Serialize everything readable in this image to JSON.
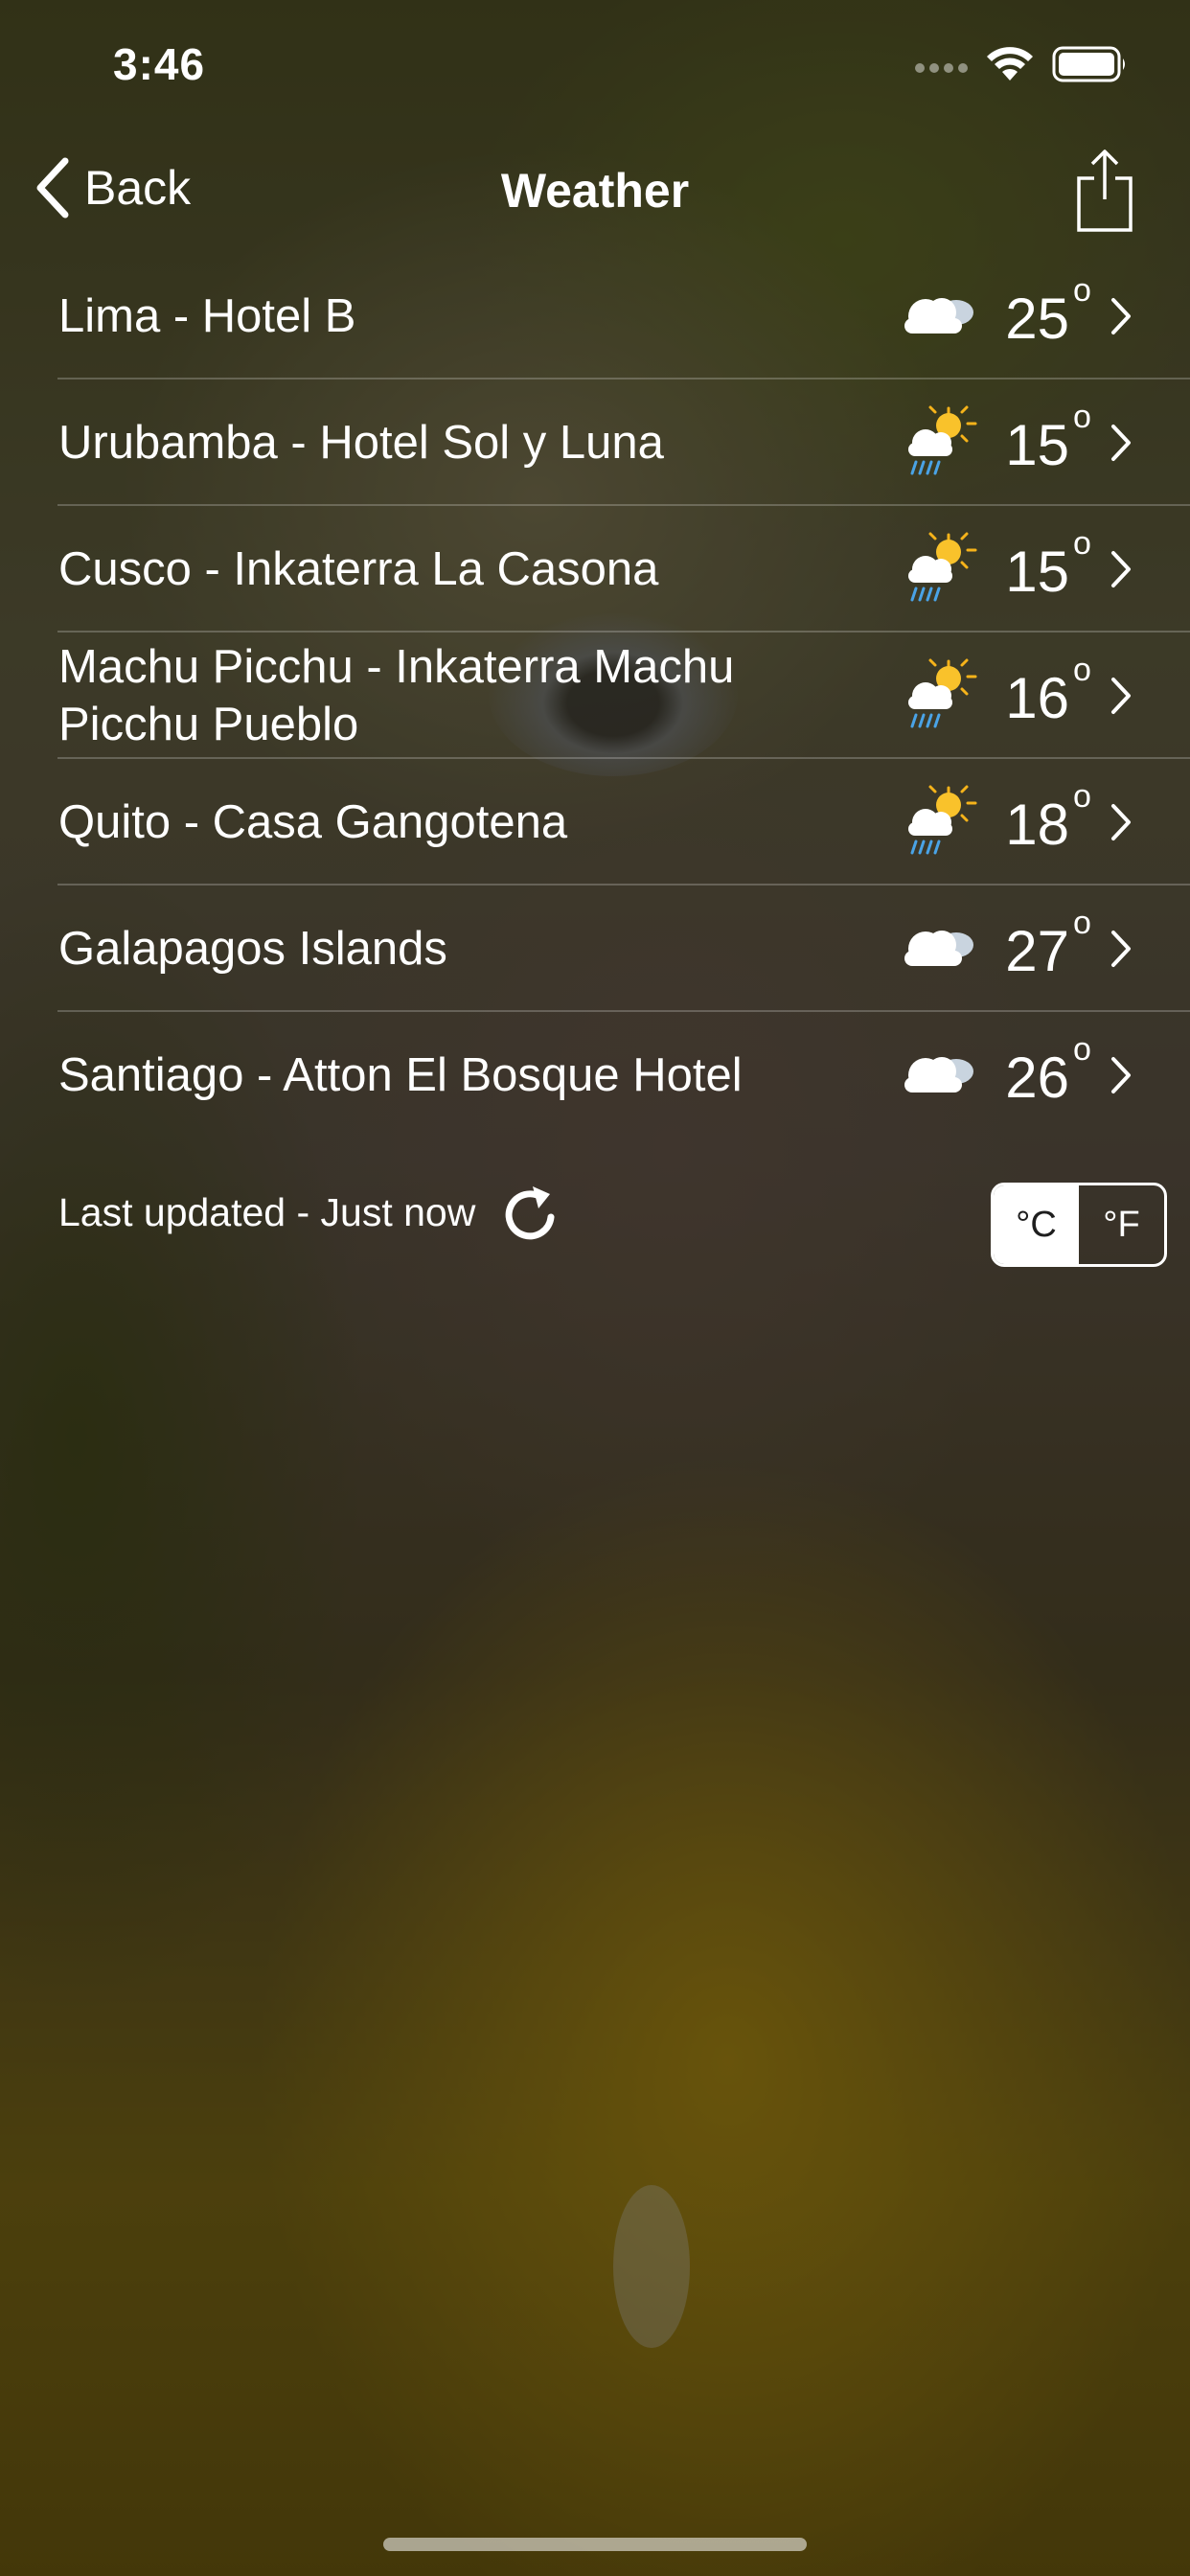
{
  "status_bar": {
    "time": "3:46"
  },
  "nav": {
    "back_label": "Back",
    "title": "Weather"
  },
  "locations": [
    {
      "name": "Lima - Hotel B",
      "temp": "25",
      "icon": "cloudy-icon"
    },
    {
      "name": "Urubamba - Hotel Sol y Luna",
      "temp": "15",
      "icon": "sun-rain-icon"
    },
    {
      "name": "Cusco - Inkaterra La Casona",
      "temp": "15",
      "icon": "sun-rain-icon"
    },
    {
      "name": "Machu Picchu - Inkaterra Machu Picchu Pueblo",
      "temp": "16",
      "icon": "sun-rain-icon"
    },
    {
      "name": "Quito - Casa Gangotena",
      "temp": "18",
      "icon": "sun-rain-icon"
    },
    {
      "name": "Galapagos Islands",
      "temp": "27",
      "icon": "cloudy-icon"
    },
    {
      "name": "Santiago - Atton El Bosque Hotel",
      "temp": "26",
      "icon": "cloudy-icon"
    }
  ],
  "degree_symbol": "o",
  "footer": {
    "updated_text": "Last updated - Just now",
    "unit_celsius": "°C",
    "unit_fahrenheit": "°F",
    "selected_unit": "celsius"
  }
}
